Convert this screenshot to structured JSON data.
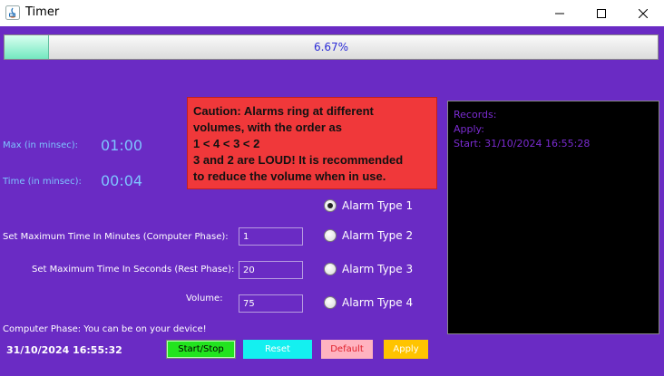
{
  "window": {
    "title": "Timer"
  },
  "progress": {
    "percent_text": "6.67%",
    "fraction": 0.0667
  },
  "timer": {
    "max_label": "Max (in minsec):",
    "max_value": "01:00",
    "time_label": "Time (in minsec):",
    "time_value": "00:04"
  },
  "caution": {
    "lines": [
      "Caution: Alarms ring at different",
      "volumes, with the order as",
      "1 < 4 < 3 < 2",
      "3 and 2 are LOUD! It is recommended",
      "to reduce the volume when in use."
    ]
  },
  "alarms": [
    {
      "label": "Alarm Type 1",
      "selected": true
    },
    {
      "label": "Alarm Type 2",
      "selected": false
    },
    {
      "label": "Alarm Type 3",
      "selected": false
    },
    {
      "label": "Alarm Type 4",
      "selected": false
    }
  ],
  "fields": {
    "computer_max_label": "Set Maximum Time In Minutes (Computer Phase):",
    "computer_max_value": "1",
    "rest_max_label": "Set Maximum Time In Seconds (Rest Phase):",
    "rest_max_value": "20",
    "volume_label": "Volume:",
    "volume_value": "75"
  },
  "records": {
    "lines": [
      "Records:",
      "Apply:",
      "Start: 31/10/2024 16:55:28"
    ]
  },
  "status": {
    "phase_text": "Computer Phase: You can be on your device!",
    "datetime": "31/10/2024 16:55:32"
  },
  "buttons": {
    "start_stop": "Start/Stop",
    "reset": "Reset",
    "default": "Default",
    "apply": "Apply"
  },
  "colors": {
    "background": "#6a2bc4",
    "caution": "#f0383a",
    "start_stop": "#22e41e",
    "reset": "#14f0f0",
    "default": "#ffb3c0",
    "apply": "#ffc400"
  }
}
